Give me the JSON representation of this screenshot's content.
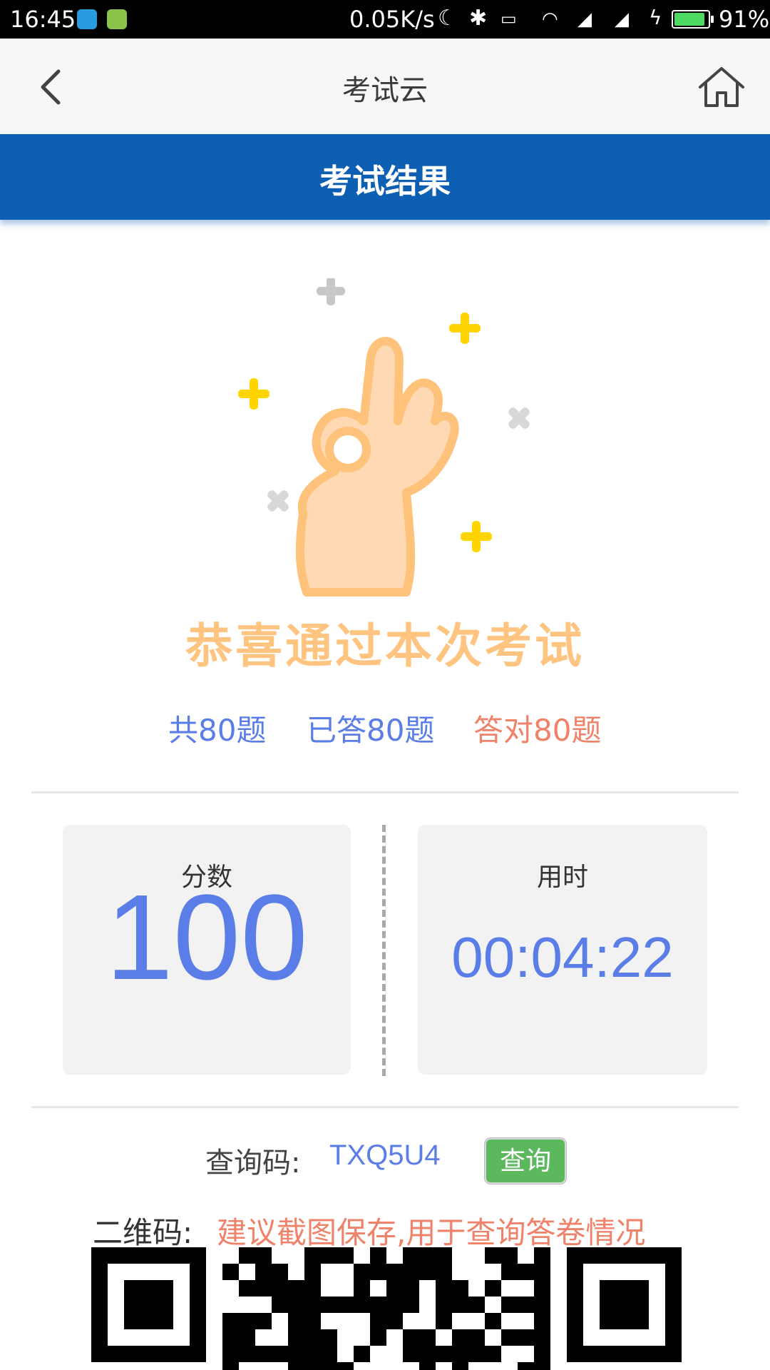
{
  "status_bar": {
    "time": "16:45",
    "speed": "0.05K/s",
    "battery": "91%",
    "battery_level": 0.91,
    "icons": [
      "usb-icon",
      "android-icon",
      "moon-icon",
      "bluetooth-icon",
      "vibrate-icon",
      "wifi-icon",
      "signal-icon",
      "signal-icon",
      "charging-icon",
      "battery-icon"
    ]
  },
  "header": {
    "title": "考试云",
    "back_icon": "chevron-left-icon",
    "home_icon": "home-icon"
  },
  "banner": {
    "title": "考试结果",
    "color": "#0d5fb3"
  },
  "result": {
    "message": "恭喜通过本次考试",
    "illustration": "ok-hand-icon",
    "total": "共80题",
    "answered": "已答80题",
    "correct": "答对80题"
  },
  "score": {
    "label": "分数",
    "value": "100"
  },
  "duration": {
    "label": "用时",
    "value": "00:04:22"
  },
  "query": {
    "label": "查询码:",
    "code": "TXQ5U4",
    "button": "查询"
  },
  "qr": {
    "label": "二维码:",
    "hint": "建议截图保存,用于查询答卷情况"
  },
  "colors": {
    "accent_blue": "#5b7de8",
    "accent_red": "#f0826a",
    "congrats": "#ffc480",
    "button_green": "#5cb85c"
  }
}
